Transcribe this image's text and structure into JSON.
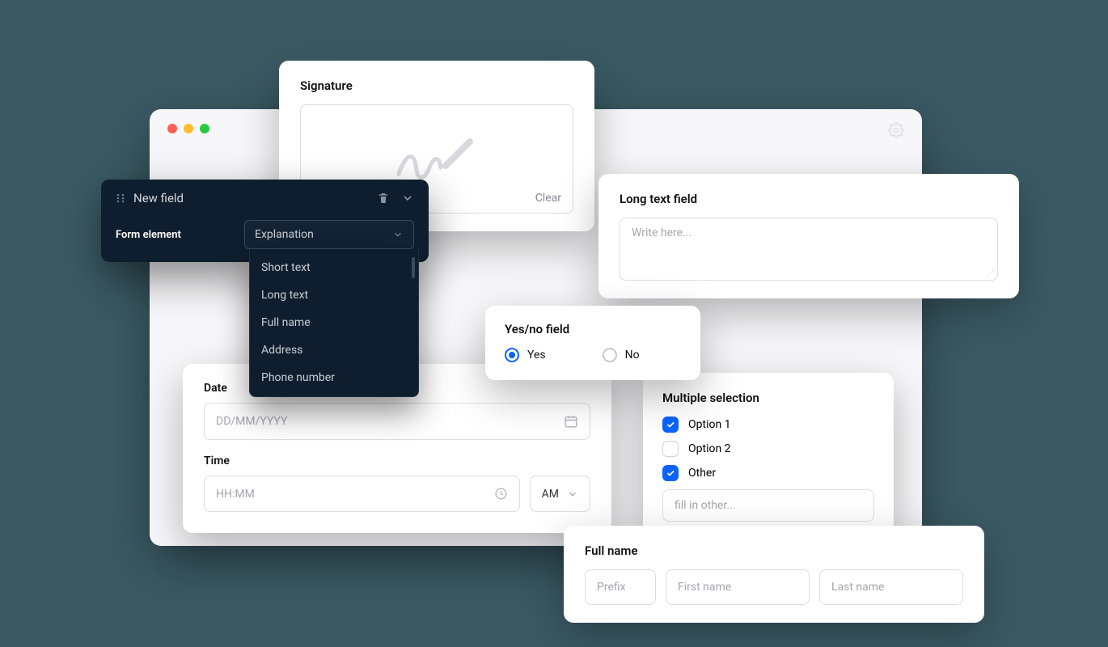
{
  "signature": {
    "title": "Signature",
    "clear": "Clear"
  },
  "longtext": {
    "title": "Long text field",
    "placeholder": "Write here..."
  },
  "yesno": {
    "title": "Yes/no field",
    "yes": "Yes",
    "no": "No"
  },
  "multiple": {
    "title": "Multiple selection",
    "options": [
      "Option 1",
      "Option 2",
      "Other"
    ],
    "fill_placeholder": "fill in other..."
  },
  "datetime": {
    "date_label": "Date",
    "date_placeholder": "DD/MM/YYYY",
    "time_label": "Time",
    "time_placeholder": "HH:MM",
    "ampm": "AM"
  },
  "fullname": {
    "title": "Full name",
    "prefix": "Prefix",
    "first": "First name",
    "last": "Last name"
  },
  "panel": {
    "title": "New field",
    "label": "Form element",
    "selected": "Explanation",
    "options": [
      "Short text",
      "Long text",
      "Full name",
      "Address",
      "Phone number"
    ]
  }
}
